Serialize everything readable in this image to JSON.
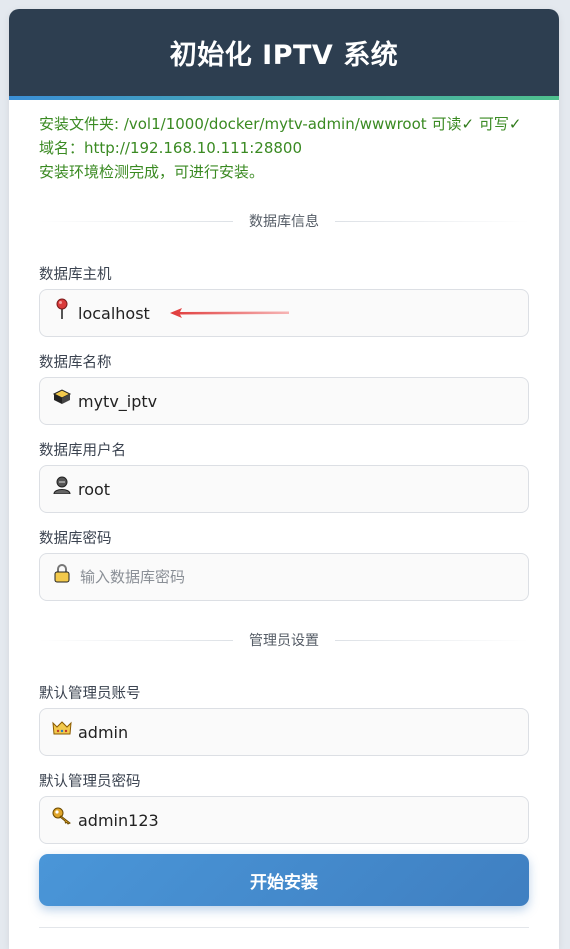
{
  "header": {
    "title": "初始化 IPTV 系统"
  },
  "env": {
    "folder_label": "安装文件夹: ",
    "folder_path": "/vol1/1000/docker/mytv-admin/wwwroot",
    "readable": "可读",
    "writable": "可写",
    "check_mark": "✓",
    "domain_label": "域名：",
    "domain_value": "http://192.168.10.111:28800",
    "status": "安装环境检测完成，可进行安装。"
  },
  "db_section": {
    "title": "数据库信息",
    "host": {
      "label": "数据库主机",
      "value": "localhost",
      "icon": "pin-icon"
    },
    "name": {
      "label": "数据库名称",
      "value": "mytv_iptv",
      "icon": "database-icon"
    },
    "user": {
      "label": "数据库用户名",
      "value": "root",
      "icon": "user-icon"
    },
    "password": {
      "label": "数据库密码",
      "value": "",
      "placeholder": "输入数据库密码",
      "icon": "lock-icon"
    }
  },
  "admin_section": {
    "title": "管理员设置",
    "account": {
      "label": "默认管理员账号",
      "value": "admin",
      "icon": "crown-icon"
    },
    "password": {
      "label": "默认管理员密码",
      "value": "admin123",
      "icon": "key-icon"
    }
  },
  "install_button": "开始安装",
  "colors": {
    "header_bg": "#2d3e50",
    "env_text": "#3a8a22",
    "button_start": "#4a96d8",
    "button_end": "#3f7fc1",
    "annotation_arrow": "#e03a3a"
  }
}
